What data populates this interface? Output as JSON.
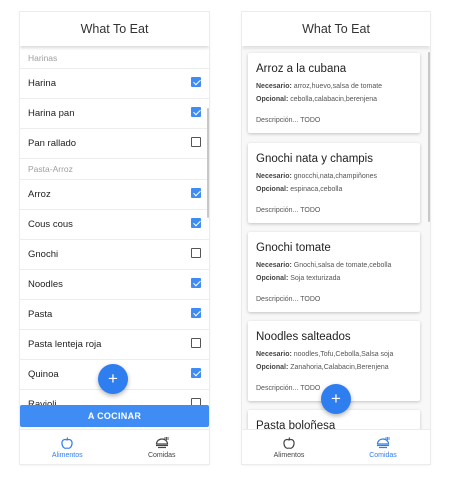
{
  "app_title": "What To Eat",
  "left": {
    "list": [
      {
        "type": "header",
        "label": "Harinas"
      },
      {
        "type": "item",
        "label": "Harina",
        "checked": true
      },
      {
        "type": "item",
        "label": "Harina pan",
        "checked": true
      },
      {
        "type": "item",
        "label": "Pan rallado",
        "checked": false
      },
      {
        "type": "header",
        "label": "Pasta-Arroz"
      },
      {
        "type": "item",
        "label": "Arroz",
        "checked": true
      },
      {
        "type": "item",
        "label": "Cous cous",
        "checked": true
      },
      {
        "type": "item",
        "label": "Gnochi",
        "checked": false
      },
      {
        "type": "item",
        "label": "Noodles",
        "checked": true
      },
      {
        "type": "item",
        "label": "Pasta",
        "checked": true
      },
      {
        "type": "item",
        "label": "Pasta lenteja roja",
        "checked": false
      },
      {
        "type": "item",
        "label": "Quinoa",
        "checked": true
      },
      {
        "type": "item",
        "label": "Ravioli",
        "checked": false
      }
    ],
    "fab_label": "+",
    "cook_button": "A COCINAR"
  },
  "right": {
    "fab_label": "+",
    "cards": [
      {
        "title": "Arroz a la cubana",
        "necesario_label": "Necesario:",
        "necesario": "arroz,huevo,salsa de tomate",
        "opcional_label": "Opcional:",
        "opcional": "cebolla,calabacin,berenjena",
        "descripcion": "Descripción... TODO"
      },
      {
        "title": "Gnochi nata y champis",
        "necesario_label": "Necesario:",
        "necesario": "gnocchi,nata,champiñones",
        "opcional_label": "Opcional:",
        "opcional": "espinaca,cebolla",
        "descripcion": "Descripción... TODO"
      },
      {
        "title": "Gnochi tomate",
        "necesario_label": "Necesario:",
        "necesario": "Gnochi,salsa de tomate,cebolla",
        "opcional_label": "Opcional:",
        "opcional": "Soja texturizada",
        "descripcion": "Descripción... TODO"
      },
      {
        "title": "Noodles salteados",
        "necesario_label": "Necesario:",
        "necesario": "noodles,Tofu,Cebolla,Salsa soja",
        "opcional_label": "Opcional:",
        "opcional": "Zanahoria,Calabacin,Berenjena",
        "descripcion": "Descripción... TODO"
      },
      {
        "title": "Pasta boloñesa",
        "necesario_label": "",
        "necesario": "",
        "opcional_label": "",
        "opcional": "",
        "descripcion": ""
      }
    ]
  },
  "nav": {
    "alimentos": "Alimentos",
    "comidas": "Comidas",
    "left_active": "alimentos",
    "right_active": "comidas"
  },
  "colors": {
    "accent": "#3f8df4",
    "fab": "#2f7ef0",
    "checkbox_checked": "#3f8df4"
  }
}
